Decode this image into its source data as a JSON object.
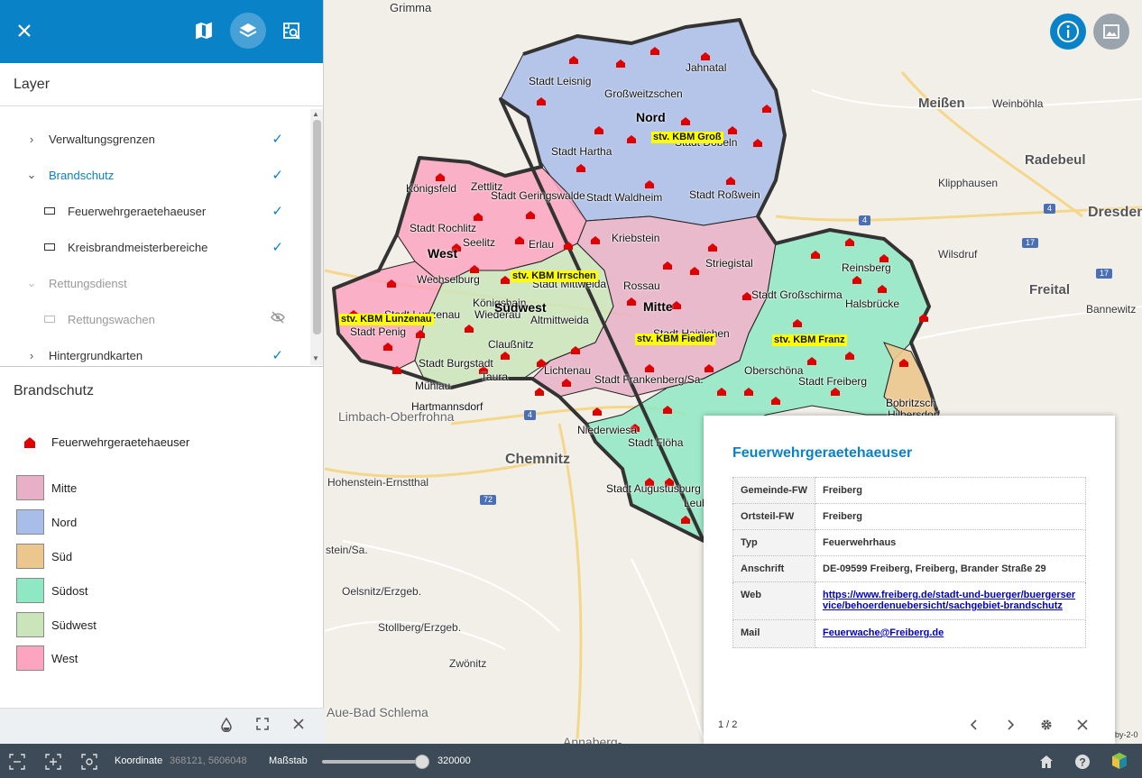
{
  "sidebar": {
    "layer_heading": "Layer",
    "layers": [
      {
        "label": "Verwaltungsgrenzen",
        "indent": 0,
        "expand": "collapsed",
        "checked": true,
        "style": "normal"
      },
      {
        "label": "Brandschutz",
        "indent": 0,
        "expand": "expanded",
        "checked": true,
        "style": "blue"
      },
      {
        "label": "Feuerwehrgeraetehaeuser",
        "indent": 1,
        "expand": "none",
        "checked": true,
        "style": "normal"
      },
      {
        "label": "Kreisbrandmeisterbereiche",
        "indent": 1,
        "expand": "none",
        "checked": true,
        "style": "normal"
      },
      {
        "label": "Rettungsdienst",
        "indent": 0,
        "expand": "expanded",
        "checked": false,
        "style": "dim"
      },
      {
        "label": "Rettungswachen",
        "indent": 1,
        "expand": "none",
        "checked": false,
        "hidden_icon": true,
        "style": "dim"
      },
      {
        "label": "Hintergrundkarten",
        "indent": 0,
        "expand": "collapsed",
        "checked": true,
        "style": "normal"
      }
    ],
    "legend_heading": "Brandschutz",
    "legend_point": "Feuerwehrgeraetehaeuser",
    "legend_items": [
      {
        "label": "Mitte",
        "color": "#e8b0c6"
      },
      {
        "label": "Nord",
        "color": "#a9bde9"
      },
      {
        "label": "Süd",
        "color": "#ecc78d"
      },
      {
        "label": "Südost",
        "color": "#8ee8c3"
      },
      {
        "label": "Südwest",
        "color": "#cbe5bb"
      },
      {
        "label": "West",
        "color": "#fca4c0"
      }
    ]
  },
  "map": {
    "cities": [
      "Grimma",
      "Meißen",
      "Weinböhla",
      "Radebeul",
      "Klipphausen",
      "Dresden",
      "Wilsdruf",
      "Freital",
      "Bannewitz",
      "Limbach-Oberfrohna",
      "Chemnitz",
      "Hohenstein-Ernstthal",
      "Oelsnitz/Erzgeb.",
      "Stollberg/Erzgeb.",
      "Zwönitz",
      "Annaberg-",
      "Aue-Bad Schlema",
      "stein/Sa."
    ],
    "districts": [
      "Stadt Leisnig",
      "Jahnatal",
      "Großweitzschen",
      "Stadt Hartha",
      "Stadt Döbeln",
      "Königsfeld",
      "Zettlitz",
      "Stadt Geringswalde",
      "Stadt Waldheim",
      "Stadt Roßwein",
      "Stadt Rochlitz",
      "Seelitz",
      "Erlau",
      "Kriebstein",
      "Striegistal",
      "Reinsberg",
      "Wechselburg",
      "Königshain",
      "Stadt Mittweida",
      "Rossau",
      "Stadt Großschirma",
      "Stadt Lunzenau",
      "Wiederau",
      "Altmittweida",
      "Halsbrücke",
      "Stadt Penig",
      "Claußnitz",
      "Stadt Hainichen",
      "Stadt Burgstadt",
      "Taura",
      "Lichtenau",
      "Oberschöna",
      "Stadt Freiberg",
      "Mühlau",
      "Stadt Frankenberg/Sa.",
      "Hartmannsdorf",
      "Niederwiesa",
      "Stadt Flöha",
      "Bobritzsch",
      "Hilbersdorf",
      "Stadt Augustusburg",
      "Leub"
    ],
    "region_labels": [
      "Nord",
      "West",
      "Mitte",
      "Südwest"
    ],
    "kbm_labels": [
      "stv. KBM Groß",
      "stv. KBM Irrschen",
      "stv. KBM Lunzenau",
      "stv. KBM Fiedler",
      "stv. KBM Franz"
    ],
    "attribution": "by-2-0"
  },
  "popup": {
    "title": "Feuerwehrgeraetehaeuser",
    "rows": [
      {
        "key": "Gemeinde-FW",
        "value": "Freiberg"
      },
      {
        "key": "Ortsteil-FW",
        "value": "Freiberg"
      },
      {
        "key": "Typ",
        "value": "Feuerwehrhaus"
      },
      {
        "key": "Anschrift",
        "value": "DE-09599 Freiberg, Freiberg, Brander Straße 29"
      },
      {
        "key": "Web",
        "value": "https://www.freiberg.de/stadt-und-buerger/buergerservice/behoerdenuebersicht/sachgebiet-brandschutz",
        "link": true
      },
      {
        "key": "Mail",
        "value": "Feuerwache@Freiberg.de",
        "link": true
      }
    ],
    "pager": "1 / 2"
  },
  "status": {
    "coord_label": "Koordinate",
    "coord_value": "368121, 5606048",
    "scale_label": "Maßstab",
    "scale_value": "320000"
  },
  "colors": {
    "primary": "#0a82c8",
    "statusbar": "#3d4a57",
    "fire_marker": "#e00000"
  }
}
